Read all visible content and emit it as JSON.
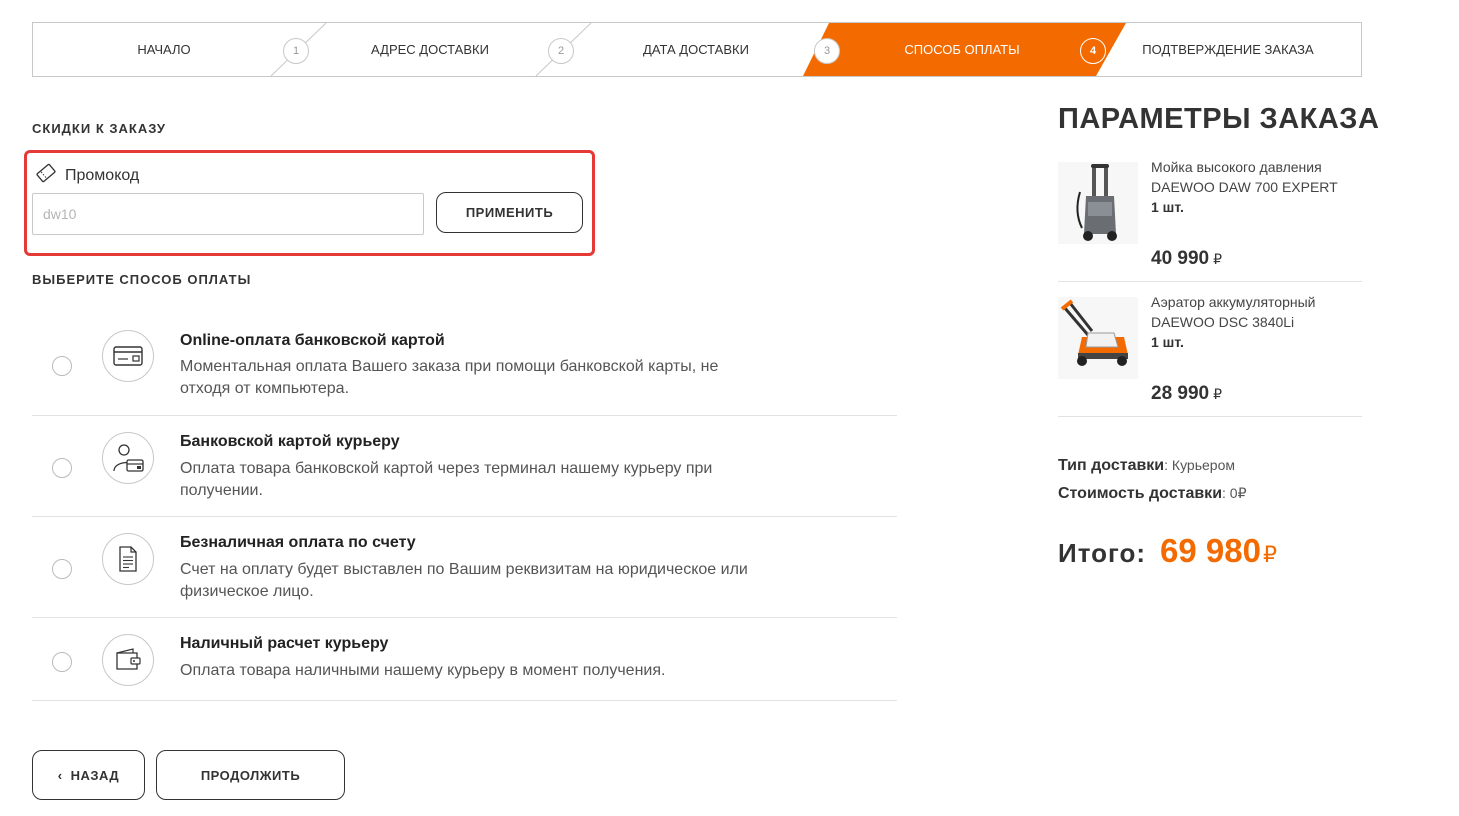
{
  "colors": {
    "accent": "#f36b00",
    "highlight_border": "#e53935"
  },
  "stepper": {
    "steps": [
      {
        "label": "НАЧАЛО",
        "number": "1"
      },
      {
        "label": "АДРЕС ДОСТАВКИ",
        "number": "2"
      },
      {
        "label": "ДАТА ДОСТАВКИ",
        "number": "3"
      },
      {
        "label": "СПОСОБ ОПЛАТЫ",
        "number": "4"
      },
      {
        "label": "ПОДТВЕРЖДЕНИЕ ЗАКАЗА",
        "number": ""
      }
    ],
    "active_step": "СПОСОБ ОПЛАТЫ"
  },
  "discounts": {
    "heading": "СКИДКИ К ЗАКАЗУ",
    "promo_label": "Промокод",
    "promo_placeholder": "dw10",
    "apply_label": "ПРИМЕНИТЬ"
  },
  "payment": {
    "heading": "ВЫБЕРИТЕ СПОСОБ ОПЛАТЫ",
    "methods": [
      {
        "title": "Online-оплата банковской картой",
        "description": "Моментальная оплата Вашего заказа при помощи банковской карты, не отходя от компьютера.",
        "icon": "credit-card-icon"
      },
      {
        "title": "Банковской картой курьеру",
        "description": "Оплата товара банковской картой через терминал нашему курьеру при получении.",
        "icon": "courier-card-icon"
      },
      {
        "title": "Безналичная оплата по счету",
        "description": "Счет на оплату будет выставлен по Вашим реквизитам на юридическое или физическое лицо.",
        "icon": "invoice-document-icon"
      },
      {
        "title": "Наличный расчет курьеру",
        "description": "Оплата товара наличными нашему курьеру в момент получения.",
        "icon": "wallet-icon"
      }
    ]
  },
  "buttons": {
    "back": "НАЗАД",
    "continue": "ПРОДОЛЖИТЬ"
  },
  "summary": {
    "title": "ПАРАМЕТРЫ ЗАКАЗА",
    "products": [
      {
        "name": "Мойка высокого давления DAEWOO DAW 700 EXPERT",
        "qty": "1 шт.",
        "price": "40 990",
        "currency": "₽"
      },
      {
        "name": "Аэратор аккумуляторный DAEWOO DSC 3840Li",
        "qty": "1 шт.",
        "price": "28 990",
        "currency": "₽"
      }
    ],
    "delivery_type_label": "Тип доставки",
    "delivery_type_value": ": Курьером",
    "delivery_cost_label": "Стоимость доставки",
    "delivery_cost_value": ": 0₽",
    "total_label": "Итого:",
    "total_value": "69 980",
    "total_currency": "₽"
  }
}
